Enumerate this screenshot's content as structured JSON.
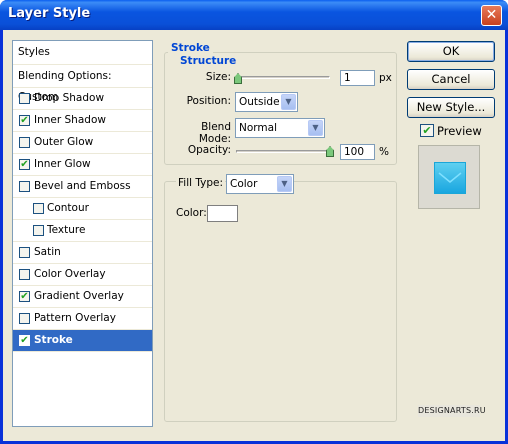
{
  "window": {
    "title": "Layer Style",
    "close_glyph": "✕"
  },
  "styles_list": {
    "header": "Styles",
    "blending": "Blending Options: Custom",
    "items": [
      {
        "label": "Drop Shadow",
        "checked": false
      },
      {
        "label": "Inner Shadow",
        "checked": true
      },
      {
        "label": "Outer Glow",
        "checked": false
      },
      {
        "label": "Inner Glow",
        "checked": true
      },
      {
        "label": "Bevel and Emboss",
        "checked": false
      },
      {
        "label": "Contour",
        "checked": false
      },
      {
        "label": "Texture",
        "checked": false
      },
      {
        "label": "Satin",
        "checked": false
      },
      {
        "label": "Color Overlay",
        "checked": false
      },
      {
        "label": "Gradient Overlay",
        "checked": true
      },
      {
        "label": "Pattern Overlay",
        "checked": false
      },
      {
        "label": "Stroke",
        "checked": true,
        "selected": true
      }
    ]
  },
  "stroke": {
    "title": "Stroke",
    "structure": {
      "title": "Structure",
      "size_label": "Size:",
      "size_value": "1",
      "size_unit": "px",
      "position_label": "Position:",
      "position_value": "Outside",
      "blend_mode_label": "Blend Mode:",
      "blend_mode_value": "Normal",
      "opacity_label": "Opacity:",
      "opacity_value": "100",
      "opacity_unit": "%"
    },
    "fill": {
      "fill_type_label": "Fill Type:",
      "fill_type_value": "Color",
      "color_label": "Color:",
      "color_value": "#ffffff"
    }
  },
  "buttons": {
    "ok": "OK",
    "cancel": "Cancel",
    "new_style": "New Style...",
    "preview_label": "Preview",
    "preview_checked": true
  },
  "watermark": "DESIGNARTS.RU"
}
